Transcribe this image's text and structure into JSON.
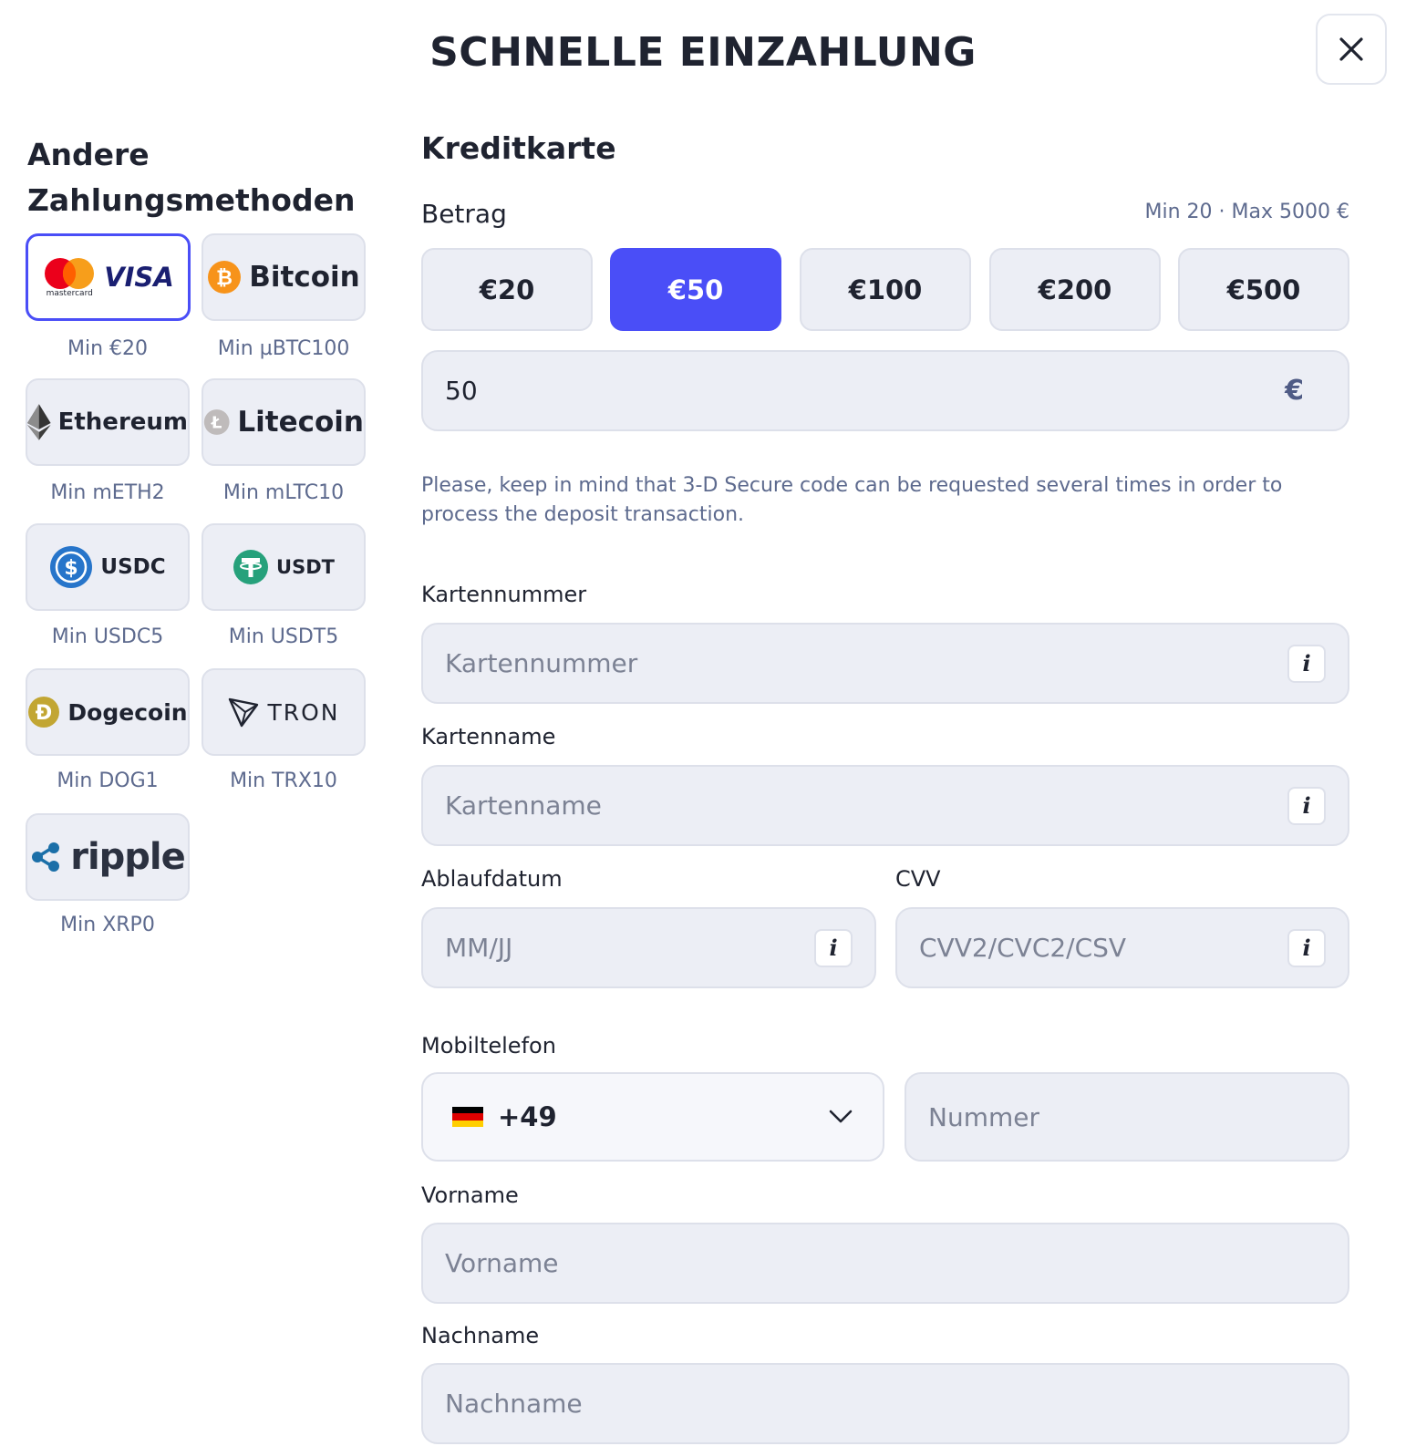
{
  "dialog": {
    "title": "SCHNELLE EINZAHLUNG"
  },
  "methods": {
    "title": "Andere Zahlungsmethoden",
    "items": [
      {
        "name": "VISA",
        "brand_small": "mastercard",
        "min": "Min €20",
        "icon": "mastercard-visa-icon"
      },
      {
        "name": "Bitcoin",
        "min": "Min µBTC100",
        "icon": "bitcoin-icon"
      },
      {
        "name": "Ethereum",
        "min": "Min mETH2",
        "icon": "ethereum-icon"
      },
      {
        "name": "Litecoin",
        "min": "Min mLTC10",
        "icon": "litecoin-icon"
      },
      {
        "name": "USDC",
        "min": "Min USDC5",
        "icon": "usdc-icon"
      },
      {
        "name": "USDT",
        "min": "Min USDT5",
        "icon": "tether-icon"
      },
      {
        "name": "Dogecoin",
        "min": "Min DOG1",
        "icon": "dogecoin-icon"
      },
      {
        "name": "TRON",
        "min": "Min TRX10",
        "icon": "tron-icon"
      },
      {
        "name": "ripple",
        "min": "Min XRP0",
        "icon": "ripple-icon"
      }
    ]
  },
  "form": {
    "title": "Kreditkarte",
    "amount_label": "Betrag",
    "range": "Min 20 · Max 5000 €",
    "presets": [
      "€20",
      "€50",
      "€100",
      "€200",
      "€500"
    ],
    "selected_preset": "€50",
    "amount_value": "50",
    "currency_symbol": "€",
    "notice": "Please, keep in mind that 3-D Secure code can be requested several times in order to process the deposit transaction.",
    "card_number": {
      "label": "Kartennummer",
      "placeholder": "Kartennummer"
    },
    "card_name": {
      "label": "Kartenname",
      "placeholder": "Kartenname"
    },
    "expiry": {
      "label": "Ablaufdatum",
      "placeholder": "MM/JJ"
    },
    "cvv": {
      "label": "CVV",
      "placeholder": "CVV2/CVC2/CSV"
    },
    "phone": {
      "label": "Mobiltelefon",
      "dial_code": "+49",
      "placeholder": "Nummer"
    },
    "first_name": {
      "label": "Vorname",
      "placeholder": "Vorname"
    },
    "last_name": {
      "label": "Nachname",
      "placeholder": "Nachname"
    },
    "info_glyph": "i"
  },
  "colors": {
    "accent": "#4a4ef7",
    "field_bg": "#eceef5",
    "muted_text": "#5d6a8e"
  }
}
